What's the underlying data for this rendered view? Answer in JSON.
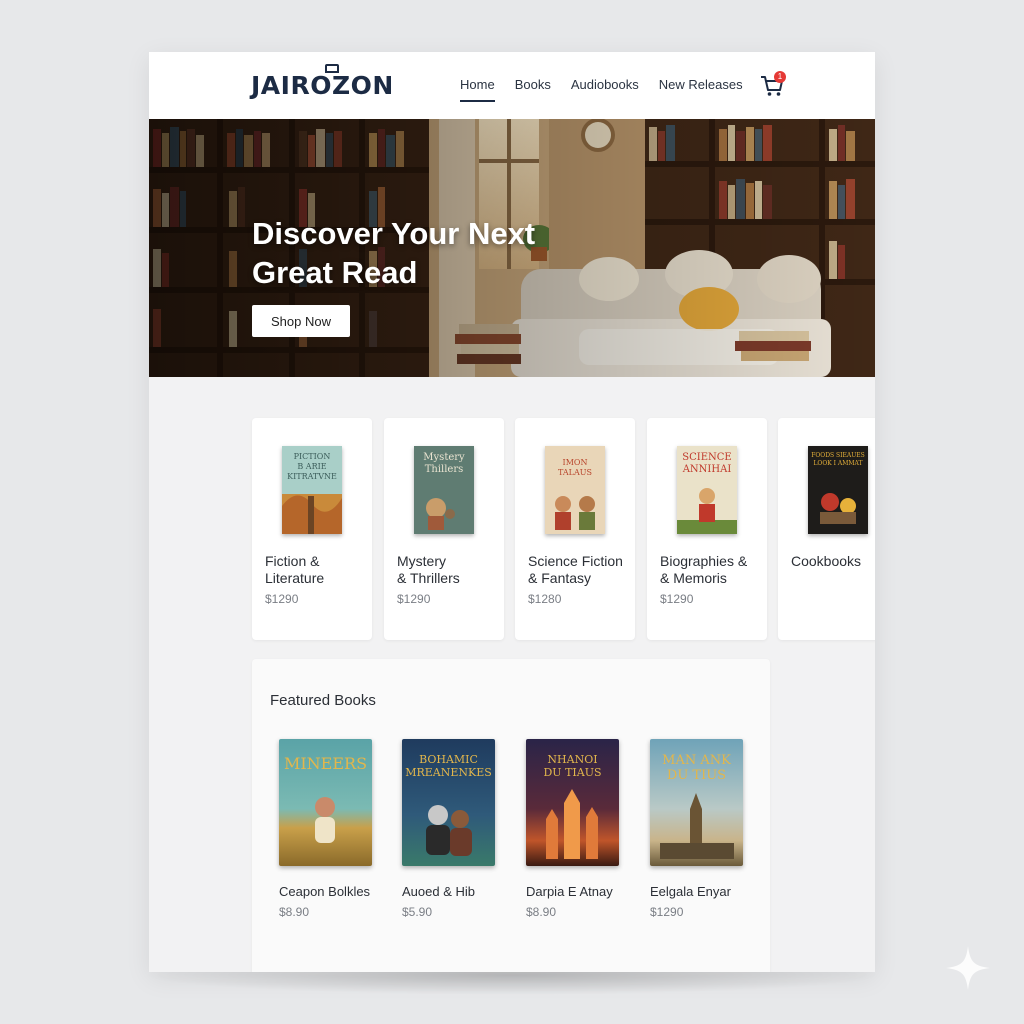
{
  "header": {
    "logo": "JAIROZON",
    "nav": [
      "Home",
      "Books",
      "Audiobooks",
      "New Releases"
    ],
    "active_nav": "Home",
    "cart_count": "1"
  },
  "hero": {
    "title_line1": "Discover Your Next",
    "title_line2": "Great Read",
    "cta_label": "Shop Now"
  },
  "categories": [
    {
      "name_line1": "Fiction &",
      "name_line2": "Literature",
      "price": "$1290",
      "cover_text": "PICTION\nB ARIE\nKITRATVNE",
      "cover_bg": "#a9cfc8",
      "cover_fg": "#3b5d5a"
    },
    {
      "name_line1": "Mystery",
      "name_line2": "& Thrillers",
      "price": "$1290",
      "cover_text": "Mystery\nThillers",
      "cover_bg": "#5f7c72",
      "cover_fg": "#e9e3d0"
    },
    {
      "name_line1": "Science Fiction",
      "name_line2": "& Fantasy",
      "price": "$1280",
      "cover_text": "IMON\nTALAUS",
      "cover_bg": "#e9d6b8",
      "cover_fg": "#b8452c"
    },
    {
      "name_line1": "Biographies &",
      "name_line2": "& Memoris",
      "price": "$1290",
      "cover_text": "SCIENCE\nANNIHAI",
      "cover_bg": "#eae2c9",
      "cover_fg": "#c0392b"
    },
    {
      "name_line1": "Cookbooks",
      "name_line2": "",
      "price": "",
      "cover_text": "FOODS SIEAUES\nLOOK I AMMAT",
      "cover_bg": "#1e1c1a",
      "cover_fg": "#e6b13a"
    }
  ],
  "featured": {
    "title": "Featured Books",
    "books": [
      {
        "title": "Ceapon Bolkles",
        "price": "$8.90",
        "cover_text": "MINEERS",
        "cover_bg": "#5aa3a7"
      },
      {
        "title": "Auoed & Hib",
        "price": "$5.90",
        "cover_text": "BOHAMIC\nMREANENKES",
        "cover_bg": "#1f3b5e"
      },
      {
        "title": "Darpia E Atnay",
        "price": "$8.90",
        "cover_text": "NHANOI\nDU TIAUS",
        "cover_bg": "#2a2448"
      },
      {
        "title": "Eelgala Enyar",
        "price": "$1290",
        "cover_text": "MAN ANK\nDU TIUS",
        "cover_bg": "#6fa3b8"
      }
    ]
  },
  "colors": {
    "brand": "#1c2b44",
    "logo_accent": "#e58e1e",
    "cart_badge": "#e53935",
    "page_bg": "#f2f2f3"
  },
  "icons": [
    "cart-icon",
    "logo-book-icon",
    "sparkle-icon"
  ]
}
